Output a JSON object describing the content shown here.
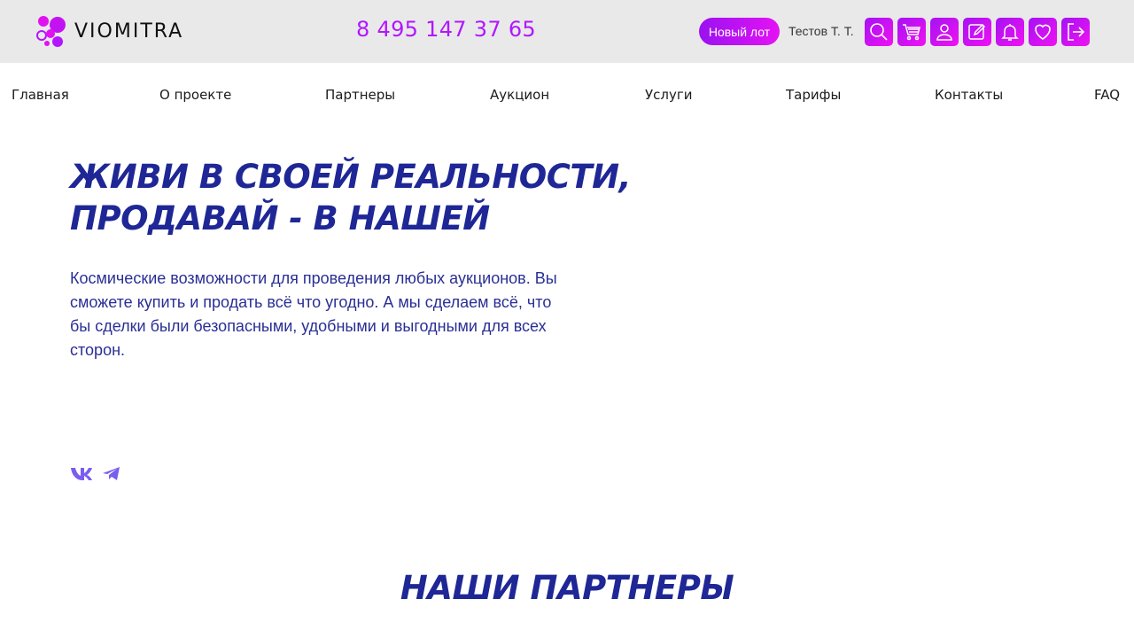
{
  "brand": {
    "name": "VIOMITRA",
    "accent": "#b216ff",
    "title_color": "#1e2795"
  },
  "header": {
    "phone": "8 495 147 37 65",
    "new_lot_label": "Новый лот",
    "user_name": "Тестов Т. Т.",
    "icons": [
      "search-icon",
      "cart-icon",
      "user-icon",
      "edit-icon",
      "bell-icon",
      "heart-icon",
      "logout-icon"
    ]
  },
  "nav": {
    "items": [
      {
        "label": "Главная"
      },
      {
        "label": "О проекте"
      },
      {
        "label": "Партнеры"
      },
      {
        "label": "Аукцион"
      },
      {
        "label": "Услуги"
      },
      {
        "label": "Тарифы"
      },
      {
        "label": "Контакты"
      },
      {
        "label": "FAQ"
      }
    ]
  },
  "hero": {
    "title_line1": "ЖИВИ В СВОЕЙ РЕАЛЬНОСТИ,",
    "title_line2": "ПРОДАВАЙ - В НАШЕЙ",
    "description": "Космические возможности для проведения любых аукционов. Вы сможете купить и продать всё что угодно. А мы сделаем всё, что бы сделки были безопасными, удобными и выгодными для всех сторон.",
    "social": [
      "vk-icon",
      "telegram-icon"
    ]
  },
  "partners": {
    "title": "НАШИ ПАРТНЕРЫ"
  }
}
